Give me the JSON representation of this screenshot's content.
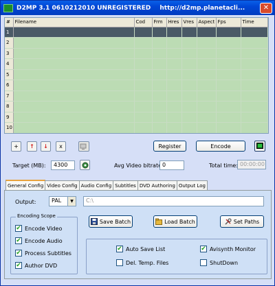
{
  "window": {
    "title": "D2MP 3.1 0610212010 UNREGISTERED",
    "url": "http://d2mp.planetacli..."
  },
  "grid": {
    "columns": [
      "#",
      "Filename",
      "Cod",
      "Frm",
      "Hres",
      "Vres",
      "Aspect",
      "Fps",
      "Time"
    ],
    "rows": [
      "1",
      "2",
      "3",
      "4",
      "5",
      "6",
      "7",
      "8",
      "9",
      "10"
    ],
    "selected_row": "1"
  },
  "toolbar": {
    "add_label": "+",
    "up_label": "↑",
    "down_label": "↓",
    "remove_label": "x",
    "register_label": "Register",
    "encode_label": "Encode"
  },
  "target": {
    "label": "Target (MB):",
    "value": "4300"
  },
  "avg_video_bitrate": {
    "label": "Avg Video bitrate:",
    "value": "0"
  },
  "total_time": {
    "label": "Total time:",
    "value": "00:00:00"
  },
  "tabs": [
    "General Config",
    "Video Config",
    "Audio Config",
    "Subtitles",
    "DVD Authoring",
    "Output Log"
  ],
  "general": {
    "output_label": "Output:",
    "output_format": "PAL",
    "output_path": "C:\\",
    "save_batch_label": "Save Batch",
    "load_batch_label": "Load Batch",
    "set_paths_label": "Set Paths",
    "encoding_scope_title": "Encoding Scope",
    "scope": [
      {
        "label": "Encode Video",
        "checked": true
      },
      {
        "label": "Encode Audio",
        "checked": true
      },
      {
        "label": "Process Subtitles",
        "checked": true
      },
      {
        "label": "Author DVD",
        "checked": true
      }
    ],
    "options": [
      {
        "label": "Auto Save List",
        "checked": true
      },
      {
        "label": "Avisynth Monitor",
        "checked": true
      },
      {
        "label": "Del. Temp. Files",
        "checked": false
      },
      {
        "label": "ShutDown",
        "checked": false
      }
    ]
  }
}
